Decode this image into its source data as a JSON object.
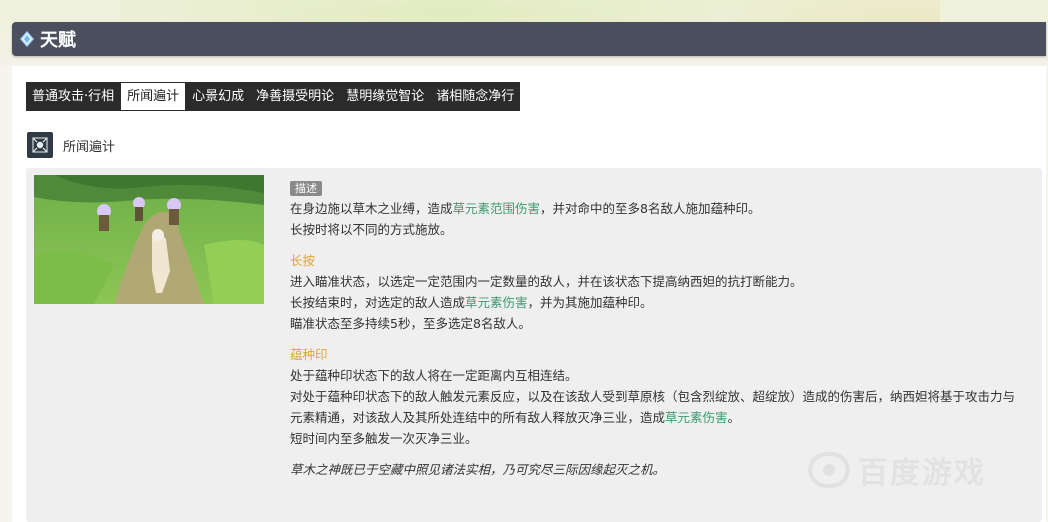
{
  "header": {
    "title": "天赋"
  },
  "tabs": [
    {
      "label": "普通攻击·行相",
      "active": false
    },
    {
      "label": "所闻遍计",
      "active": true
    },
    {
      "label": "心景幻成",
      "active": false
    },
    {
      "label": "净善摄受明论",
      "active": false
    },
    {
      "label": "慧明缘觉智论",
      "active": false
    },
    {
      "label": "诸相随念净行",
      "active": false
    }
  ],
  "skill": {
    "name": "所闻遍计",
    "icon": "skill-icon"
  },
  "description": {
    "badge": "描述",
    "p1_a": "在身边施以草木之业缚，造成",
    "p1_b": "草元素范围伤害",
    "p1_c": "，并对命中的至多8名敌人施加蕴种印。",
    "p2": "长按时将以不同的方式施放。",
    "h_hold": "长按",
    "p3": "进入瞄准状态，以选定一定范围内一定数量的敌人，并在该状态下提高纳西妲的抗打断能力。",
    "p4_a": "长按结束时，对选定的敌人造成",
    "p4_b": "草元素伤害",
    "p4_c": "，并为其施加蕴种印。",
    "p5": "瞄准状态至多持续5秒，至多选定8名敌人。",
    "h_seed": "蕴种印",
    "p6": "处于蕴种印状态下的敌人将在一定距离内互相连结。",
    "p7": "对处于蕴种印状态下的敌人触发元素反应，以及在该敌人受到草原核（包含烈绽放、超绽放）造成的伤害后，纳西妲将基于攻击力与",
    "p8_a": "元素精通，对该敌人及其所处连结中的所有敌人释放灭净三业，造成",
    "p8_b": "草元素伤害",
    "p8_c": "。",
    "p9": "短时间内至多触发一次灭净三业。",
    "quote": "草木之神既已于空藏中照见诸法实相，乃可究尽三际因缘起灭之机。"
  },
  "watermark": {
    "text": "百度游戏"
  },
  "colors": {
    "header_bg": "#4b4f5e",
    "tab_bg": "#2b2b2b",
    "green": "#3f9a72",
    "orange": "#e0a43a"
  }
}
